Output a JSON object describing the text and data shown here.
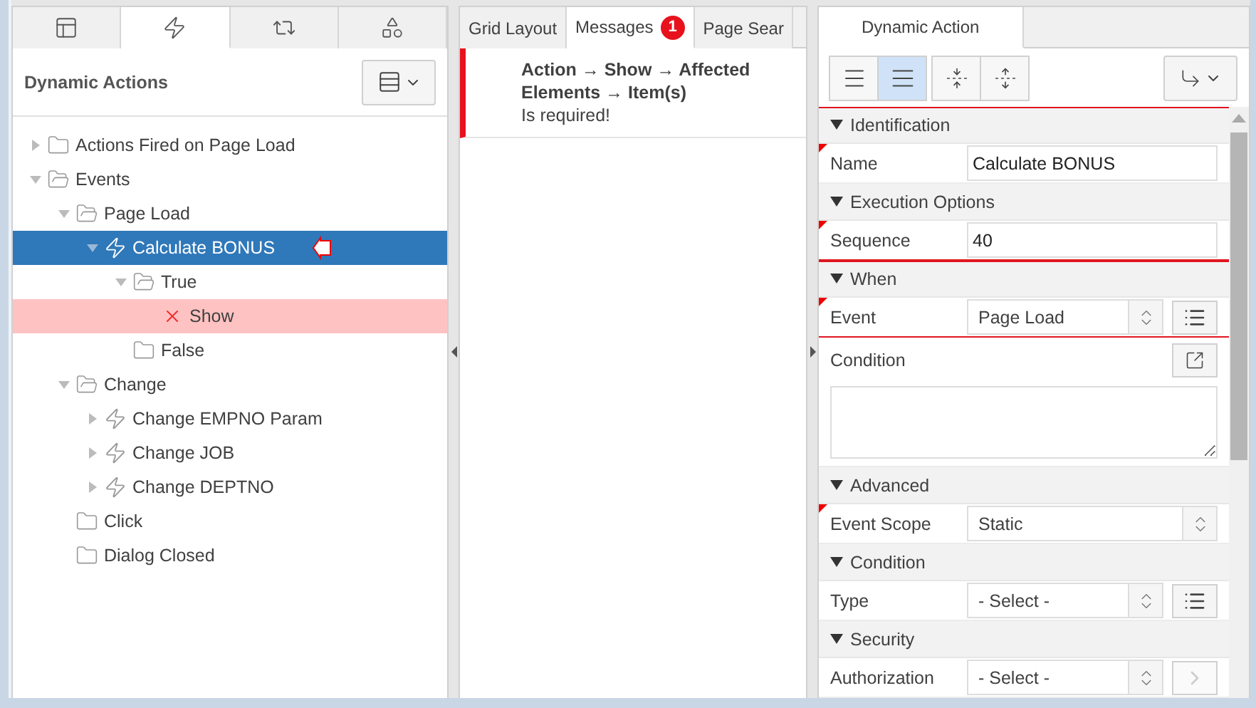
{
  "left_panel": {
    "tabs": [
      {
        "kind": "layout",
        "selected": false
      },
      {
        "kind": "events",
        "selected": true
      },
      {
        "kind": "shared",
        "selected": false
      },
      {
        "kind": "components",
        "selected": false
      }
    ],
    "title": "Dynamic Actions",
    "tree": [
      {
        "label": "Actions Fired on Page Load",
        "kind": "folder",
        "expanded": false,
        "selected": false,
        "error": false
      },
      {
        "label": "Events",
        "kind": "folder",
        "expanded": true,
        "selected": false,
        "error": false,
        "children": [
          {
            "label": "Page Load",
            "kind": "folder",
            "expanded": true,
            "selected": false,
            "error": false,
            "children": [
              {
                "label": "Calculate BONUS",
                "kind": "event",
                "expanded": true,
                "selected": true,
                "error": false,
                "pointer": true,
                "children": [
                  {
                    "label": "True",
                    "kind": "folder",
                    "expanded": true,
                    "selected": false,
                    "error": false,
                    "children": [
                      {
                        "label": "Show",
                        "kind": "action",
                        "selected": false,
                        "error": true
                      }
                    ]
                  },
                  {
                    "label": "False",
                    "kind": "folder",
                    "selected": false,
                    "error": false
                  }
                ]
              }
            ]
          },
          {
            "label": "Change",
            "kind": "folder",
            "expanded": true,
            "selected": false,
            "error": false,
            "children": [
              {
                "label": "Change EMPNO Param",
                "kind": "event",
                "expanded": false,
                "selected": false,
                "error": false
              },
              {
                "label": "Change JOB",
                "kind": "event",
                "expanded": false,
                "selected": false,
                "error": false
              },
              {
                "label": "Change DEPTNO",
                "kind": "event",
                "expanded": false,
                "selected": false,
                "error": false
              }
            ]
          },
          {
            "label": "Click",
            "kind": "folder",
            "selected": false,
            "error": false
          },
          {
            "label": "Dialog Closed",
            "kind": "folder",
            "selected": false,
            "error": false
          }
        ]
      }
    ]
  },
  "middle_panel": {
    "tabs": [
      {
        "label": "Grid Layout",
        "selected": false
      },
      {
        "label": "Messages",
        "selected": true,
        "badge": "1"
      },
      {
        "label": "Page Sear",
        "selected": false
      }
    ],
    "messages": [
      {
        "title": "Action → Show → Affected Elements → Item(s)",
        "text": "Is required!"
      }
    ]
  },
  "right_panel": {
    "tab": "Dynamic Action",
    "view_buttons": [
      {
        "kind": "compact",
        "selected": false
      },
      {
        "kind": "expanded",
        "selected": true
      }
    ],
    "tool_buttons": [
      {
        "kind": "collapse"
      },
      {
        "kind": "expand"
      }
    ],
    "blocks": [
      {
        "highlighted": true,
        "sections": [
          {
            "title": "Identification",
            "rows": [
              {
                "kind": "text",
                "label": "Name",
                "value": "Calculate BONUS",
                "required": true
              }
            ]
          },
          {
            "title": "Execution Options",
            "rows": [
              {
                "kind": "text",
                "label": "Sequence",
                "value": "40",
                "required": true
              }
            ]
          }
        ]
      },
      {
        "highlighted": true,
        "sections": [
          {
            "title": "When",
            "rows": [
              {
                "kind": "select",
                "label": "Event",
                "value": "Page Load",
                "required": true,
                "button": {
                  "kind": "list"
                }
              }
            ]
          }
        ]
      },
      {
        "highlighted": false,
        "sections": [
          {
            "rows": [
              {
                "kind": "textarea",
                "label": "Condition",
                "required": false
              }
            ]
          },
          {
            "title": "Advanced",
            "rows": [
              {
                "kind": "select",
                "label": "Event Scope",
                "value": "Static",
                "required": true
              }
            ]
          },
          {
            "title": "Condition",
            "rows": [
              {
                "kind": "select",
                "label": "Type",
                "value": "- Select -",
                "required": false,
                "button": {
                  "kind": "list"
                }
              }
            ]
          },
          {
            "title": "Security",
            "rows": [
              {
                "kind": "select",
                "label": "Authorization",
                "value": "- Select -",
                "required": false,
                "button": {
                  "kind": "go"
                }
              }
            ]
          }
        ]
      }
    ]
  }
}
